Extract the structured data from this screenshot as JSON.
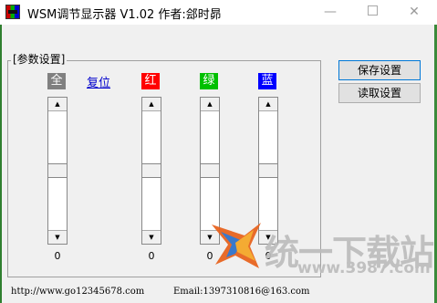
{
  "window": {
    "title": "WSM调节显示器  V1.02    作者:郐时昴",
    "minimize": "—",
    "close": "✕"
  },
  "group": {
    "title": "[参数设置]"
  },
  "buttons": {
    "save": "保存设置",
    "read": "读取设置"
  },
  "reset_link": "复位",
  "channels": [
    {
      "label": "全",
      "color": "#808080",
      "value": "0"
    },
    {
      "label": "红",
      "color": "#ff0000",
      "value": "0"
    },
    {
      "label": "绿",
      "color": "#00c000",
      "value": "0"
    },
    {
      "label": "蓝",
      "color": "#0000ff",
      "value": "0"
    }
  ],
  "scroll_arrows": {
    "up": "▲",
    "down": "▼"
  },
  "footer": {
    "website": "http://www.go12345678.com",
    "email": "Email:1397310816@163.com"
  },
  "watermark": {
    "text": "统一下载站",
    "url": "www.3987.com"
  }
}
